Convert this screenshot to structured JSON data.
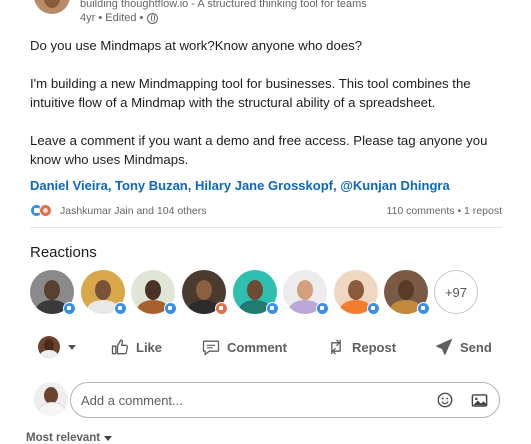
{
  "post": {
    "author_subtitle": "building thoughtflow.io - A structured thinking tool for teams",
    "time": "4yr • Edited •",
    "paragraphs": [
      "Do you use Mindmaps at work?Know anyone who does?",
      "I'm building a new Mindmapping tool for businesses. This tool combines the intuitive flow of a Mindmap with the structural ability of a spreadsheet.",
      "Leave a comment if you want a demo and free access. Please tag anyone you know who uses Mindmaps."
    ],
    "tags": {
      "t1": "Daniel Vieira",
      "t2": "Tony Buzan",
      "t3": "Hilary Jane Grosskopf",
      "t4": "@Kunjan Dhingra",
      "sep": ", "
    }
  },
  "social": {
    "reactors": "Jashkumar Jain and 104 others",
    "counts": "110 comments • 1 repost"
  },
  "reactions": {
    "title": "Reactions",
    "more": "+97"
  },
  "actions": {
    "like": "Like",
    "comment": "Comment",
    "repost": "Repost",
    "send": "Send"
  },
  "comment_box": {
    "placeholder": "Add a comment..."
  },
  "sort": {
    "label": "Most relevant"
  },
  "colors": {
    "link": "#0a66c2",
    "like_badge": "#378fe9",
    "love_badge": "#df704d"
  }
}
